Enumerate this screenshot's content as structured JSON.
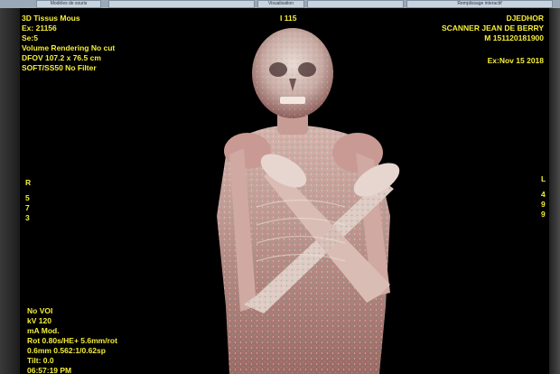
{
  "toolbar": {
    "tabs": [
      "Modèles de souris",
      "",
      "Visualisation",
      "",
      "Remplissage interactif"
    ]
  },
  "overlay": {
    "top_left": [
      "3D Tissus Mous",
      "Ex: 21156",
      "Se:5",
      "Volume Rendering No cut",
      "DFOV 107.2 x 76.5 cm",
      "SOFT/SS50 No Filter"
    ],
    "top_center": "I 115",
    "top_right": [
      "DJEDHOR",
      "SCANNER JEAN DE BERRY",
      "M 151120181900"
    ],
    "exam_date": "Ex:Nov 15 2018",
    "left_orientation": [
      "R",
      "5",
      "7",
      "3"
    ],
    "right_orientation": [
      "L",
      "4",
      "9",
      "9"
    ],
    "bottom_left": [
      "No VOI",
      "kV 120",
      "mA Mod.",
      "Rot 0.80s/HE+ 5.6mm/rot",
      "0.6mm 0.562:1/0.62sp",
      "Tilt: 0.0",
      "06:57:19 PM"
    ]
  },
  "colors": {
    "overlay_text": "#f6ee3a",
    "viewport_bg": "#000000",
    "bone": "#d8c6bf",
    "tissue": "#c58a86"
  },
  "icons": []
}
